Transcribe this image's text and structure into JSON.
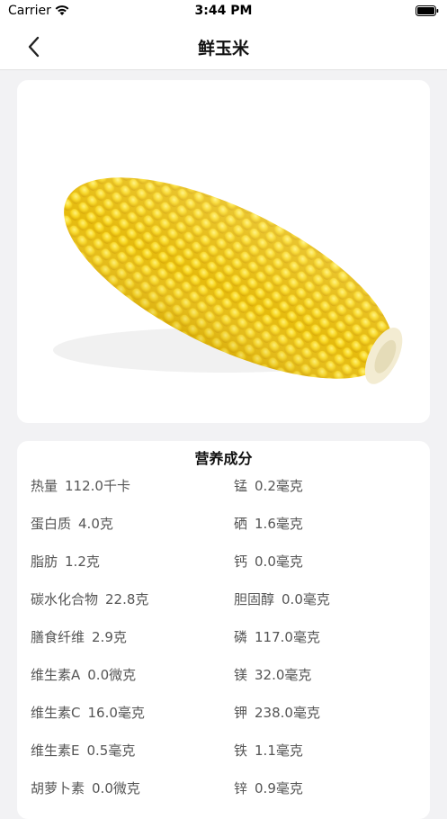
{
  "status": {
    "carrier": "Carrier",
    "time": "3:44 PM"
  },
  "nav": {
    "title": "鲜玉米",
    "back_icon": "chevron-left-icon"
  },
  "image": {
    "subject": "corn-cob",
    "colors": {
      "kernel": "#f6d31a",
      "kernel_light": "#fce44a",
      "husk": "#f2ead0"
    }
  },
  "nutrition": {
    "title": "营养成分",
    "rows": [
      {
        "left": {
          "name": "热量",
          "value": "112.0千卡"
        },
        "right": {
          "name": "锰",
          "value": "0.2毫克"
        }
      },
      {
        "left": {
          "name": "蛋白质",
          "value": "4.0克"
        },
        "right": {
          "name": "硒",
          "value": "1.6毫克"
        }
      },
      {
        "left": {
          "name": "脂肪",
          "value": "1.2克"
        },
        "right": {
          "name": "钙",
          "value": "0.0毫克"
        }
      },
      {
        "left": {
          "name": "碳水化合物",
          "value": "22.8克"
        },
        "right": {
          "name": "胆固醇",
          "value": "0.0毫克"
        }
      },
      {
        "left": {
          "name": "膳食纤维",
          "value": "2.9克"
        },
        "right": {
          "name": "磷",
          "value": "117.0毫克"
        }
      },
      {
        "left": {
          "name": "维生素A",
          "value": "0.0微克"
        },
        "right": {
          "name": "镁",
          "value": "32.0毫克"
        }
      },
      {
        "left": {
          "name": "维生素C",
          "value": "16.0毫克"
        },
        "right": {
          "name": "钾",
          "value": "238.0毫克"
        }
      },
      {
        "left": {
          "name": "维生素E",
          "value": "0.5毫克"
        },
        "right": {
          "name": "铁",
          "value": "1.1毫克"
        }
      },
      {
        "left": {
          "name": "胡萝卜素",
          "value": "0.0微克"
        },
        "right": {
          "name": "锌",
          "value": "0.9毫克"
        }
      }
    ]
  }
}
